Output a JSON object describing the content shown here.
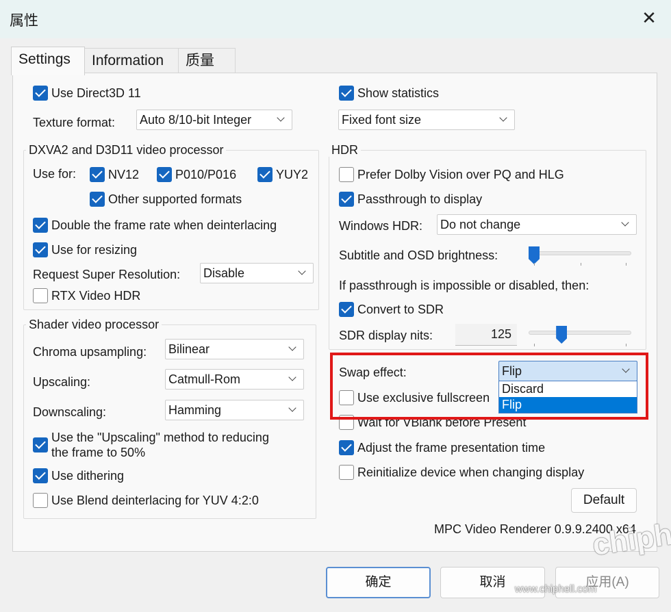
{
  "window": {
    "title": "属性",
    "close_glyph": "✕"
  },
  "tabs": [
    {
      "label": "Settings",
      "active": true
    },
    {
      "label": "Information",
      "active": false
    },
    {
      "label": "质量",
      "active": false
    }
  ],
  "left": {
    "use_d3d11": {
      "label": "Use Direct3D 11",
      "checked": true
    },
    "texture_format": {
      "label": "Texture format:",
      "value": "Auto 8/10-bit Integer"
    },
    "dxva_group": {
      "title": "DXVA2 and D3D11 video processor",
      "use_for_label": "Use for:",
      "nv12": {
        "label": "NV12",
        "checked": true
      },
      "p010": {
        "label": "P010/P016",
        "checked": true
      },
      "yuy2": {
        "label": "YUY2",
        "checked": true
      },
      "other": {
        "label": "Other supported formats",
        "checked": true
      },
      "double_rate": {
        "label": "Double the frame rate when deinterlacing",
        "checked": true
      },
      "resizing": {
        "label": "Use for resizing",
        "checked": true
      },
      "super_res": {
        "label": "Request Super Resolution:",
        "value": "Disable"
      },
      "rtx_hdr": {
        "label": "RTX Video HDR",
        "checked": false
      }
    },
    "shader_group": {
      "title": "Shader video processor",
      "chroma": {
        "label": "Chroma upsampling:",
        "value": "Bilinear"
      },
      "upscaling": {
        "label": "Upscaling:",
        "value": "Catmull-Rom"
      },
      "downscaling": {
        "label": "Downscaling:",
        "value": "Hamming"
      },
      "upscale_method": {
        "label_line1": "Use the \"Upscaling\" method to reducing",
        "label_line2": "the frame to 50%",
        "checked": true
      },
      "dithering": {
        "label": "Use dithering",
        "checked": true
      },
      "blend": {
        "label": "Use Blend deinterlacing for YUV 4:2:0",
        "checked": false
      }
    }
  },
  "right": {
    "show_stats": {
      "label": "Show statistics",
      "checked": true
    },
    "font_size": {
      "value": "Fixed font size"
    },
    "hdr_group": {
      "title": "HDR",
      "dolby": {
        "label": "Prefer Dolby Vision over PQ and HLG",
        "checked": false
      },
      "passthrough": {
        "label": "Passthrough to display",
        "checked": true
      },
      "windows_hdr": {
        "label": "Windows HDR:",
        "value": "Do not change"
      },
      "brightness": {
        "label": "Subtitle and OSD brightness:",
        "level": 0.0
      },
      "fallback_text": "If passthrough is impossible or disabled, then:",
      "convert_sdr": {
        "label": "Convert to SDR",
        "checked": true
      },
      "sdr_nits": {
        "label": "SDR display nits:",
        "value": "125",
        "level": 0.3
      }
    },
    "swap_effect": {
      "label": "Swap effect:",
      "value": "Flip",
      "options": [
        "Discard",
        "Flip"
      ],
      "selected": "Flip"
    },
    "exclusive_fullscreen": {
      "label": "Use exclusive fullscreen",
      "checked": false
    },
    "vblank": {
      "label": "Wait for VBlank before Present",
      "checked": false
    },
    "adjust_time": {
      "label": "Adjust the frame presentation time",
      "checked": true
    },
    "reinit": {
      "label": "Reinitialize device when changing display",
      "checked": false
    },
    "default_button": "Default",
    "version": "MPC Video Renderer 0.9.9.2400 x64"
  },
  "footer": {
    "ok": "确定",
    "cancel": "取消",
    "apply": "应用(A)"
  },
  "watermark": {
    "logo_text": "chiphell",
    "url": "www.chiphell.com"
  },
  "colors": {
    "accent": "#1566c0",
    "highlight": "#0078d7",
    "annotation": "#e01818"
  }
}
